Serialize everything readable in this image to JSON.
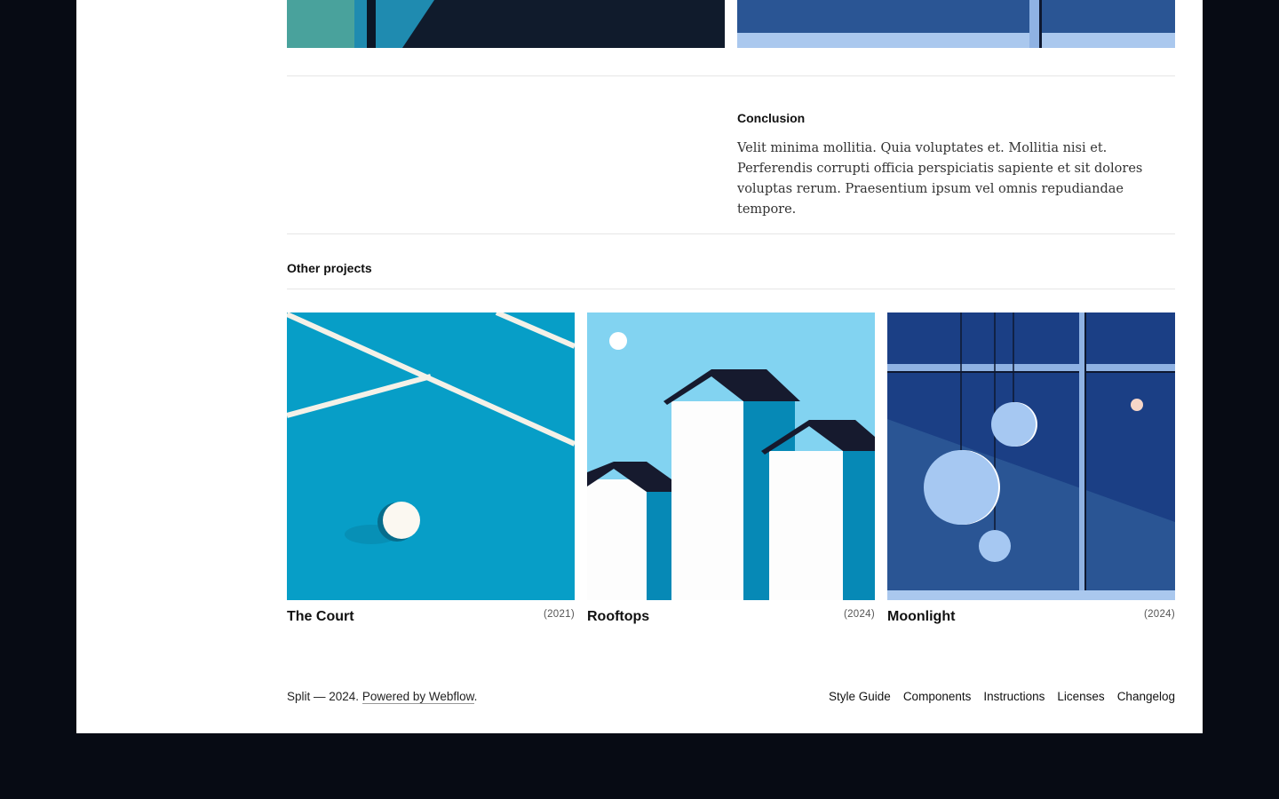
{
  "conclusion": {
    "heading": "Conclusion",
    "body": "Velit minima mollitia. Quia voluptates et. Mollitia nisi et. Perferendis corrupti officia perspiciatis sapiente et sit dolores voluptas rerum. Praesentium ipsum vel omnis repudiandae tempore."
  },
  "other_projects": {
    "heading": "Other projects",
    "items": [
      {
        "title": "The Court",
        "year": "(2021)"
      },
      {
        "title": "Rooftops",
        "year": "(2024)"
      },
      {
        "title": "Moonlight",
        "year": "(2024)"
      }
    ]
  },
  "footer": {
    "credit_prefix": "Split — 2024.",
    "powered_link": "Powered by Webflow",
    "credit_suffix": ".",
    "links": [
      "Style Guide",
      "Components",
      "Instructions",
      "Licenses",
      "Changelog"
    ]
  },
  "colors": {
    "page_background": "#070b14",
    "panel": "#ffffff",
    "court_blue": "#079ec7",
    "sky_blue": "#82d3f1",
    "night_blue": "#1b3f85"
  }
}
